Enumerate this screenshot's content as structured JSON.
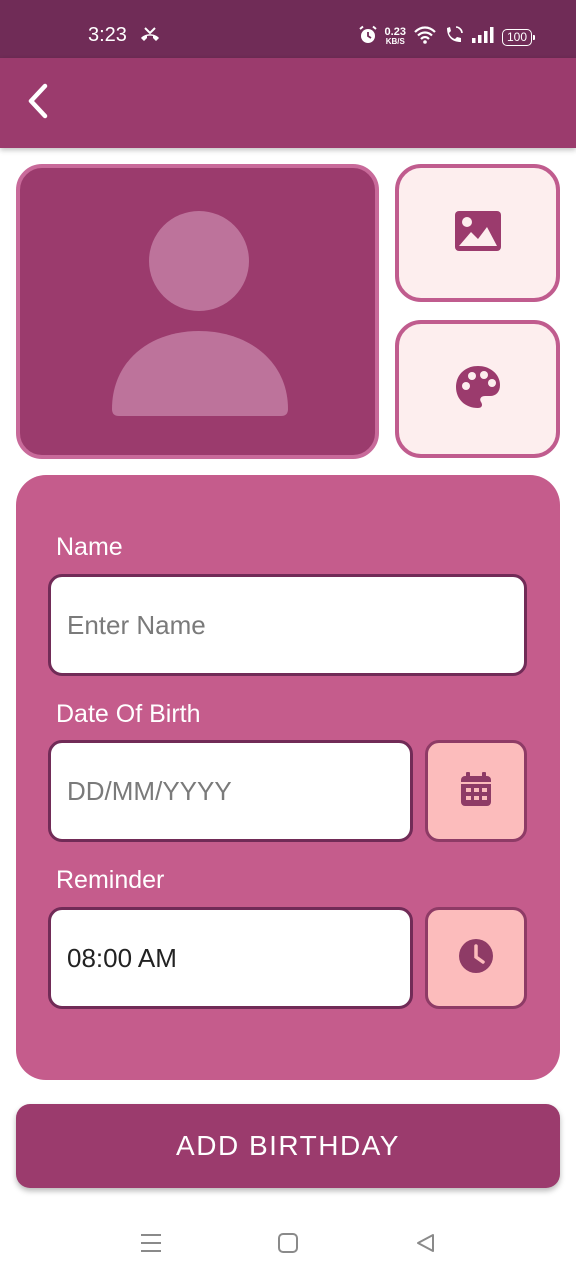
{
  "status_bar": {
    "time": "3:23",
    "left_icon": "missed-call-icon",
    "net_speed_value": "0.23",
    "net_speed_unit": "KB/S",
    "battery": "100",
    "icons": [
      "alarm-icon",
      "wifi-icon",
      "wifi-calling-icon",
      "signal-icon",
      "battery-icon"
    ]
  },
  "app_bar": {
    "back_icon": "back-arrow-icon"
  },
  "photo": {
    "avatar_icon": "person-placeholder-icon",
    "gallery_icon": "image-icon",
    "theme_icon": "palette-icon"
  },
  "form": {
    "name_label": "Name",
    "name_placeholder": "Enter Name",
    "dob_label": "Date Of Birth",
    "dob_placeholder": "DD/MM/YYYY",
    "calendar_icon": "calendar-icon",
    "reminder_label": "Reminder",
    "reminder_value": "08:00 AM",
    "clock_icon": "clock-icon"
  },
  "submit_label": "ADD BIRTHDAY",
  "nav_bar": {
    "items": [
      "menu-icon",
      "home-square-icon",
      "back-triangle-icon"
    ]
  },
  "colors": {
    "status_bar": "#702c57",
    "primary": "#9b3b6d",
    "card": "#c55c8c",
    "light_tile": "#fdeeee",
    "pink_button": "#fcbcbc",
    "input_border": "#712b57"
  }
}
